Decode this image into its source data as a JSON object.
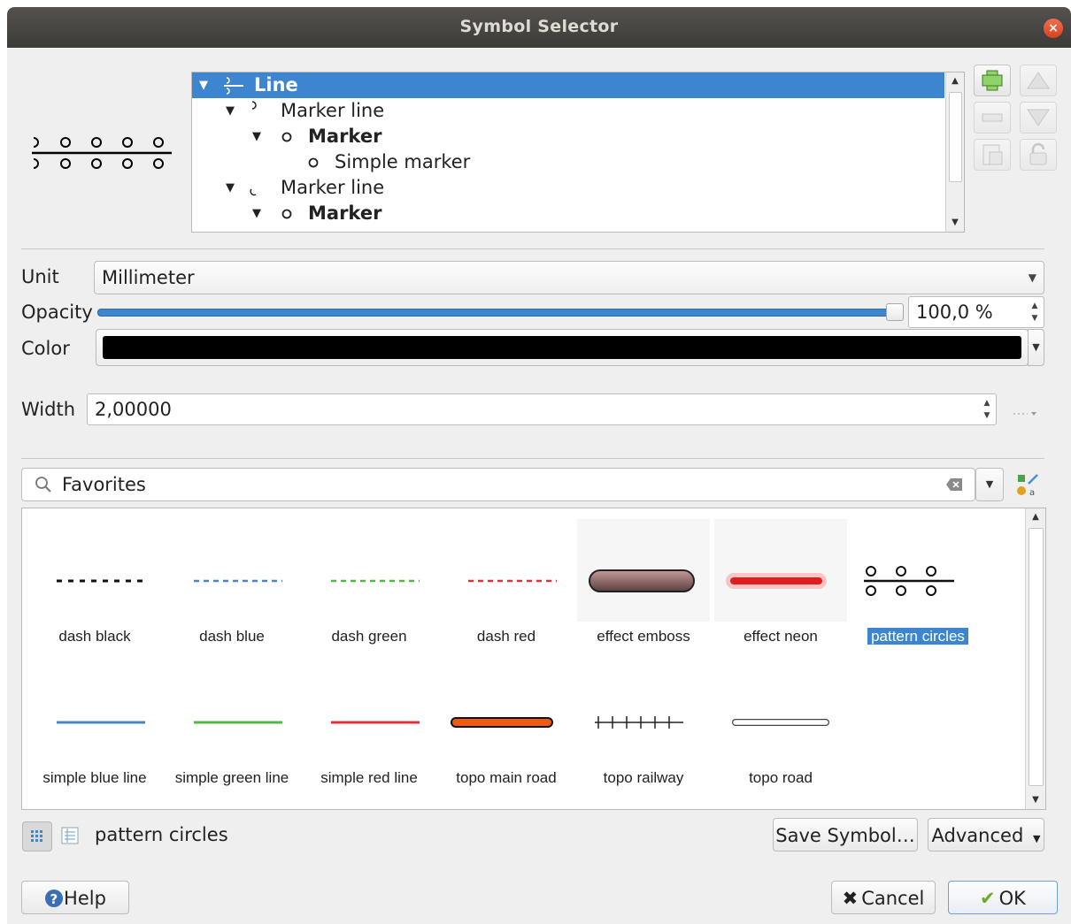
{
  "window": {
    "title": "Symbol Selector",
    "close_label": "×"
  },
  "layer_tree": {
    "rows": [
      {
        "label": "Line",
        "bold": true,
        "selected": true
      },
      {
        "label": "Marker line",
        "bold": false
      },
      {
        "label": "Marker",
        "bold": true
      },
      {
        "label": "Simple marker",
        "bold": false
      },
      {
        "label": "Marker line",
        "bold": false
      },
      {
        "label": "Marker",
        "bold": true
      }
    ]
  },
  "layer_buttons": [
    "add-layer",
    "remove-layer",
    "move-up",
    "move-down",
    "duplicate-layer",
    "lock-layer"
  ],
  "properties": {
    "unit_label": "Unit",
    "unit_value": "Millimeter",
    "opacity_label": "Opacity",
    "opacity_value": "100,0 %",
    "opacity_level": 1.0,
    "color_label": "Color",
    "color_value": "#000000",
    "width_label": "Width",
    "width_value": "2,00000"
  },
  "search": {
    "value": "Favorites"
  },
  "gallery": {
    "items": [
      {
        "label": "dash  black",
        "icon": "dash-black"
      },
      {
        "label": "dash blue",
        "icon": "dash-blue"
      },
      {
        "label": "dash green",
        "icon": "dash-green"
      },
      {
        "label": "dash red",
        "icon": "dash-red"
      },
      {
        "label": "effect emboss",
        "icon": "effect-emboss"
      },
      {
        "label": "effect neon",
        "icon": "effect-neon"
      },
      {
        "label": "pattern circles",
        "icon": "pattern-circles",
        "selected": true
      },
      {
        "label": "simple blue line",
        "icon": "simple-blue-line"
      },
      {
        "label": "simple green line",
        "icon": "simple-green-line"
      },
      {
        "label": "simple red line",
        "icon": "simple-red-line"
      },
      {
        "label": "topo main road",
        "icon": "topo-main-road"
      },
      {
        "label": "topo railway",
        "icon": "topo-railway"
      },
      {
        "label": "topo road",
        "icon": "topo-road"
      }
    ]
  },
  "footer": {
    "selected_symbol_name": "pattern circles",
    "save_symbol": "Save Symbol…",
    "advanced": "Advanced",
    "help": "Help",
    "cancel": "Cancel",
    "ok": "OK"
  },
  "colors": {
    "accent": "#3d86cf",
    "titlebar": "#3c3b37",
    "close": "#e95420"
  }
}
